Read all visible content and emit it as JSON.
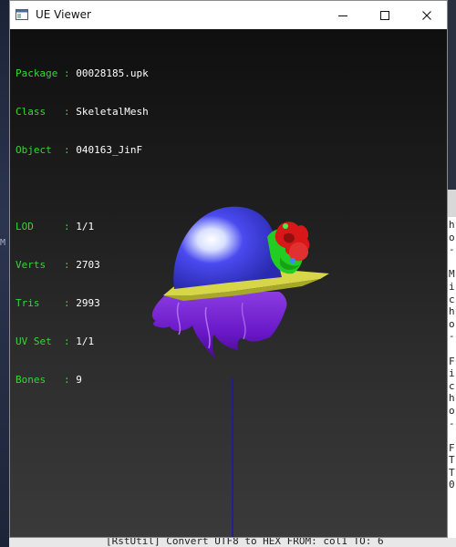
{
  "window": {
    "title": "UE Viewer",
    "icons": {
      "app": "window-app-icon",
      "minimize": "minimize-icon",
      "maximize": "maximize-icon",
      "close": "close-icon"
    }
  },
  "info": {
    "package": {
      "key": "Package",
      "value": "00028185.upk"
    },
    "class": {
      "key": "Class  ",
      "value": "SkeletalMesh"
    },
    "object": {
      "key": "Object ",
      "value": "040163_JinF"
    },
    "lod": {
      "key": "LOD    ",
      "value": "1/1"
    },
    "verts": {
      "key": "Verts  ",
      "value": "2703"
    },
    "tris": {
      "key": "Tris   ",
      "value": "2993"
    },
    "uvset": {
      "key": "UV Set ",
      "value": "1/1"
    },
    "bones": {
      "key": "Bones  ",
      "value": "9"
    },
    "separator": " : "
  },
  "colors": {
    "label": "#39d339",
    "value": "#ffffff",
    "hat_crown": "#3a3ad8",
    "hat_brim": "#d6d648",
    "hair": "#7a22d0",
    "flower": "#d81818",
    "leaf": "#22cc22",
    "bone_line": "#1a1aaa"
  },
  "background": {
    "left_char": "M",
    "right_lines": "h\no\n-\n\nM\ni\nc\nh\no\n-\n\nF\ni\nc\nh\no\n-\n\nF\nT\nT\n0",
    "bottom_text": "[RstUtil] Convert UTF8 to HEX  FROM: col1  TO: 6"
  }
}
